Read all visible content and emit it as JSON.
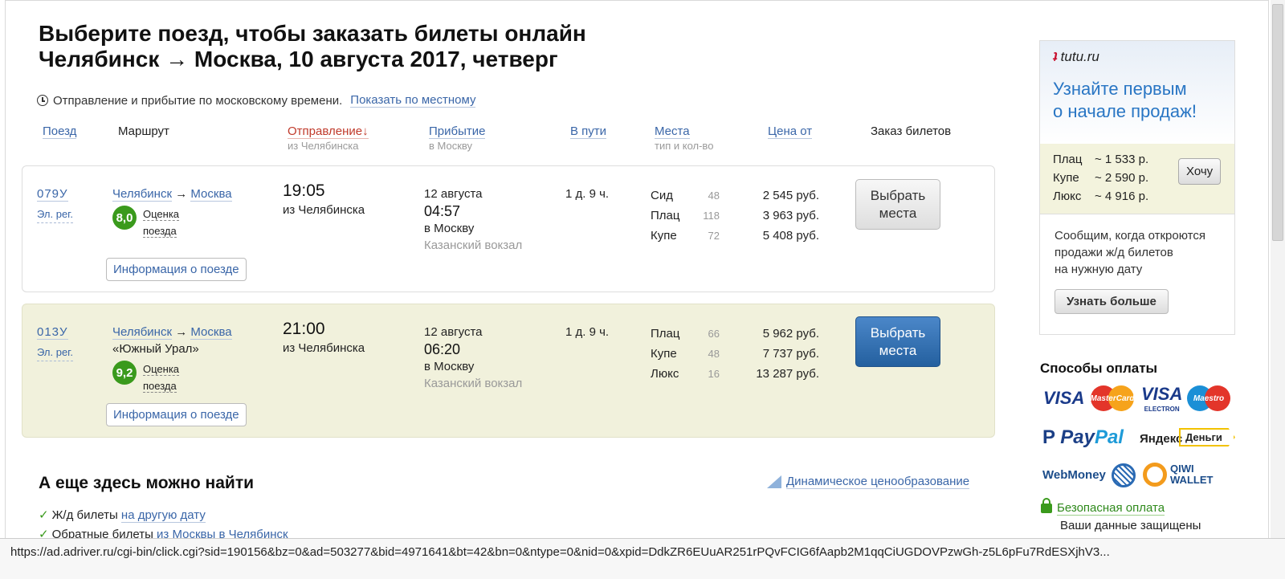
{
  "page": {
    "title_line1": "Выберите поезд, чтобы заказать билеты онлайн",
    "title_line2": "Челябинск → Москва, 10 августа 2017, четверг",
    "time_note": "Отправление и прибытие по московскому времени.",
    "time_note_link": "Показать по местному"
  },
  "columns": {
    "train": "Поезд",
    "route": "Маршрут",
    "departure": "Отправление↓",
    "departure_sub": "из Челябинска",
    "arrival": "Прибытие",
    "arrival_sub": "в Москву",
    "travel": "В пути",
    "seats": "Места",
    "seats_sub": "тип и кол-во",
    "price": "Цена от",
    "booking": "Заказ билетов"
  },
  "trains": [
    {
      "number": "079У",
      "type": "Эл. рег.",
      "from": "Челябинск",
      "arrow": "→",
      "to": "Москва",
      "name": "",
      "rating": "8,0",
      "rating_label_1": "Оценка",
      "rating_label_2": "поезда",
      "info_button": "Информация о поезде",
      "dep_time": "19:05",
      "dep_from": "из Челябинска",
      "arr_date": "12 августа",
      "arr_time": "04:57",
      "arr_to": "в Москву",
      "arr_station": "Казанский вокзал",
      "travel": "1 д. 9 ч.",
      "seats": [
        {
          "type": "Сид",
          "count": "48",
          "price": "2 545 руб."
        },
        {
          "type": "Плац",
          "count": "118",
          "price": "3 963 руб."
        },
        {
          "type": "Купе",
          "count": "72",
          "price": "5 408 руб."
        }
      ],
      "select_button_1": "Выбрать",
      "select_button_2": "места"
    },
    {
      "number": "013У",
      "type": "Эл. рег.",
      "from": "Челябинск",
      "arrow": "→",
      "to": "Москва",
      "name": "«Южный Урал»",
      "rating": "9,2",
      "rating_label_1": "Оценка",
      "rating_label_2": "поезда",
      "info_button": "Информация о поезде",
      "dep_time": "21:00",
      "dep_from": "из Челябинска",
      "arr_date": "12 августа",
      "arr_time": "06:20",
      "arr_to": "в Москву",
      "arr_station": "Казанский вокзал",
      "travel": "1 д. 9 ч.",
      "seats": [
        {
          "type": "Плац",
          "count": "66",
          "price": "5 962 руб."
        },
        {
          "type": "Купе",
          "count": "48",
          "price": "7 737 руб."
        },
        {
          "type": "Люкс",
          "count": "16",
          "price": "13 287 руб."
        }
      ],
      "select_button_1": "Выбрать",
      "select_button_2": "места"
    }
  ],
  "also": {
    "title": "А еще здесь можно найти",
    "dynamic_pricing": "Динамическое ценообразование",
    "item1_text": "Ж/д билеты",
    "item1_link": "на другую дату",
    "item2_text": "Обратные билеты",
    "item2_link": "из Москвы в Челябинск"
  },
  "ad": {
    "logo": "tutu.ru",
    "headline_1": "Узнайте первым",
    "headline_2": "о начале продаж!",
    "prices": [
      {
        "type": "Плац",
        "value": "~ 1 533 р."
      },
      {
        "type": "Купе",
        "value": "~ 2 590 р."
      },
      {
        "type": "Люкс",
        "value": "~ 4 916 р."
      }
    ],
    "want_button": "Хочу",
    "desc_1": "Сообщим, когда откроются",
    "desc_2": "продажи ж/д билетов",
    "desc_3": "на нужную дату",
    "more_button": "Узнать больше"
  },
  "payment": {
    "title": "Способы оплаты",
    "visa": "VISA",
    "mastercard": "MasterCard",
    "visa_electron": "VISA",
    "electron": "ELECTRON",
    "maestro": "Maestro",
    "paypal_1": "Pay",
    "paypal_2": "Pal",
    "yandex": "Яндекс",
    "dengi": "Деньги",
    "webmoney": "WebMoney",
    "qiwi_1": "QIWI",
    "qiwi_2": "WALLET",
    "secure_link": "Безопасная оплата",
    "secure_text": "Ваши данные защищены"
  },
  "status_url": "https://ad.adriver.ru/cgi-bin/click.cgi?sid=190156&bz=0&ad=503277&bid=4971641&bt=42&bn=0&ntype=0&nid=0&xpid=DdkZR6EUuAR251rPQvFCIG6fAapb2M1qqCiUGDOVPzwGh-z5L6pFu7RdESXjhV3..."
}
